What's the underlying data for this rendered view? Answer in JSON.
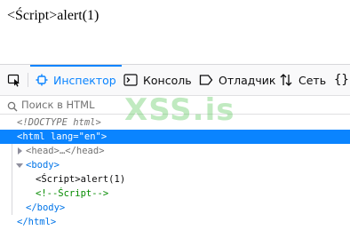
{
  "page": {
    "text": "<Ścript>alert(1)"
  },
  "toolbar": {
    "tools": [
      {
        "label": "",
        "icon": "element-picker-icon"
      },
      {
        "label": "Инспектор",
        "icon": "inspector-icon",
        "active": true
      },
      {
        "label": "Консоль",
        "icon": "console-icon"
      },
      {
        "label": "Отладчик",
        "icon": "debugger-icon"
      },
      {
        "label": "Сеть",
        "icon": "network-icon"
      },
      {
        "label": "",
        "icon": "style-editor-icon"
      }
    ],
    "inspector_label": "Инспектор",
    "console_label": "Консоль",
    "debugger_label": "Отладчик",
    "network_label": "Сеть",
    "style_editor_glyph": "{}"
  },
  "search": {
    "placeholder": "Поиск в HTML"
  },
  "tree": {
    "doctype": "<!DOCTYPE html>",
    "html_open_tag": "<html",
    "html_attr_name": "lang",
    "html_attr_eq": "=",
    "html_attr_value": "\"en\"",
    "html_open_end": ">",
    "head_collapsed": "<head>",
    "head_ellipsis": "…",
    "head_close": "</head>",
    "body_open": "<body>",
    "body_text": "<Ścript>alert(1)",
    "body_comment": "<!--Ścript-->",
    "body_close": "</body>",
    "html_close": "</html>"
  },
  "watermark": {
    "text": "XSS.is"
  },
  "colors": {
    "accent": "#0a84ff",
    "watermark": "#3cbe3c"
  }
}
